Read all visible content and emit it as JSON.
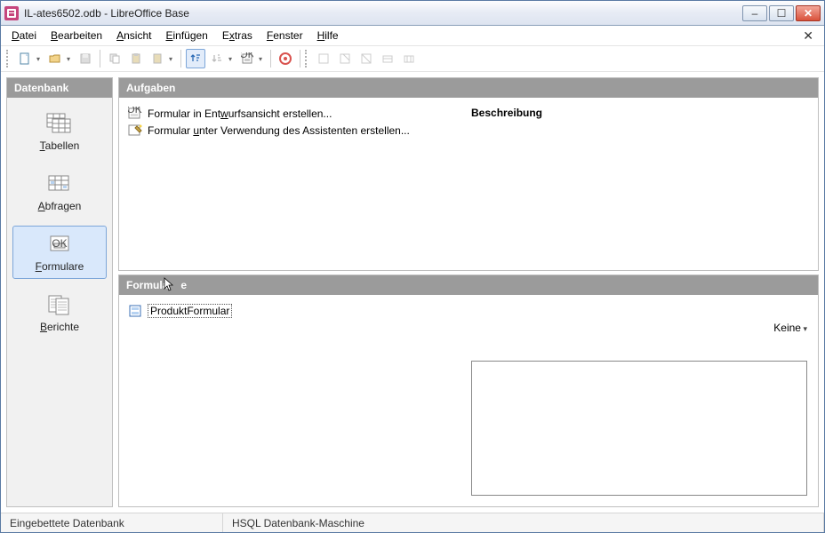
{
  "titlebar": {
    "text": "IL-ates6502.odb - LibreOffice Base"
  },
  "menu": {
    "file": "Datei",
    "file_u": "D",
    "edit": "Bearbeiten",
    "edit_u": "B",
    "view": "Ansicht",
    "view_u": "A",
    "insert": "Einfügen",
    "insert_u": "E",
    "tools": "Extras",
    "tools_u": "x",
    "window": "Fenster",
    "window_u": "F",
    "help": "Hilfe",
    "help_u": "H"
  },
  "sidebar": {
    "header": "Datenbank",
    "tables": "Tabellen",
    "tables_u": "T",
    "queries": "Abfragen",
    "queries_u": "A",
    "forms": "Formulare",
    "forms_u": "F",
    "reports": "Berichte",
    "reports_u": "B"
  },
  "tasks": {
    "header": "Aufgaben",
    "item1": "Formular in Entwurfsansicht erstellen...",
    "item1_u": "w",
    "item2": "Formular unter Verwendung des Assistenten erstellen...",
    "item2_u": "u",
    "desc_title": "Beschreibung"
  },
  "forms": {
    "header": "Formula",
    "header_rest": "e",
    "entry": "ProduktFormular",
    "view_mode": "Keine"
  },
  "status": {
    "embedded": "Eingebettete Datenbank",
    "engine": "HSQL Datenbank-Maschine"
  },
  "icons": {
    "app": "app-icon",
    "min": "–",
    "max": "☐",
    "close": "✕"
  }
}
